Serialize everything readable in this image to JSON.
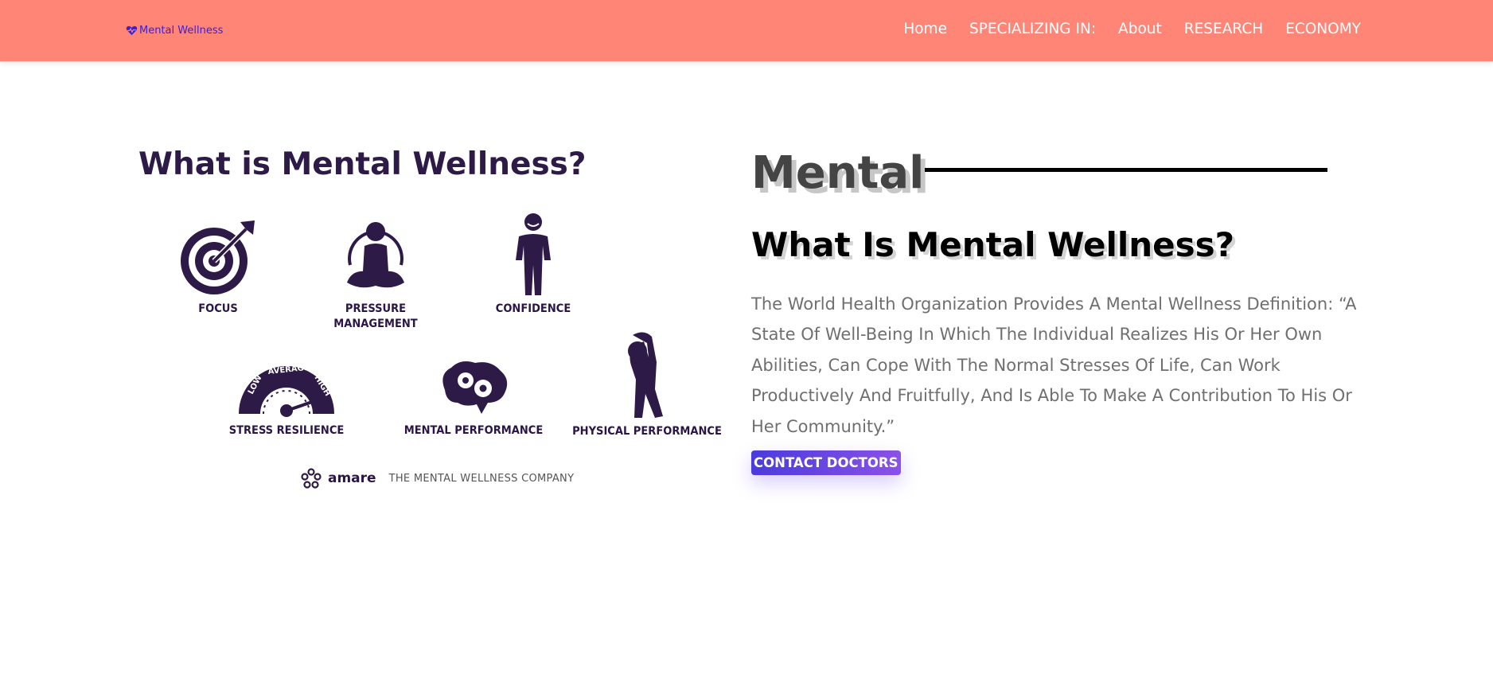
{
  "header": {
    "logo_text": "Mental Wellness",
    "logo_icon": "heart-pulse-icon",
    "nav": [
      {
        "label": "Home"
      },
      {
        "label": "SPECIALIZING IN:"
      },
      {
        "label": "About"
      },
      {
        "label": "RESEARCH"
      },
      {
        "label": "ECONOMY"
      }
    ]
  },
  "illustration": {
    "title": "What is Mental Wellness?",
    "items": [
      {
        "label": "FOCUS",
        "icon": "target-icon"
      },
      {
        "label": "PRESSURE\nMANAGEMENT",
        "icon": "meditation-icon"
      },
      {
        "label": "CONFIDENCE",
        "icon": "person-standing-icon"
      },
      {
        "label": "STRESS RESILIENCE",
        "icon": "gauge-icon"
      },
      {
        "label": "MENTAL PERFORMANCE",
        "icon": "brain-gears-icon"
      },
      {
        "label": "PHYSICAL PERFORMANCE",
        "icon": "stretching-person-icon"
      }
    ],
    "gauge_labels": [
      "LOW",
      "AVERAGE",
      "HIGH"
    ],
    "brand": {
      "name": "amare",
      "tagline": "THE MENTAL WELLNESS COMPANY"
    }
  },
  "main": {
    "eyebrow": "Mental",
    "heading": "What Is Mental Wellness?",
    "body": "The World Health Organization Provides A Mental Wellness Definition: “A State Of Well-Being In Which The Individual Realizes His Or Her Own Abilities, Can Cope With The Normal Stresses Of Life, Can Work Productively And Fruitfully, And Is Able To Make A Contribution To His Or Her Community.”",
    "cta_label": "CONTACT DOCTORS"
  },
  "colors": {
    "header_bg": "#ff8577",
    "logo": "#3b1fd6",
    "illustration_ink": "#2e1a47",
    "cta_gradient_start": "#4a3bdc",
    "cta_gradient_end": "#8a52e8"
  }
}
